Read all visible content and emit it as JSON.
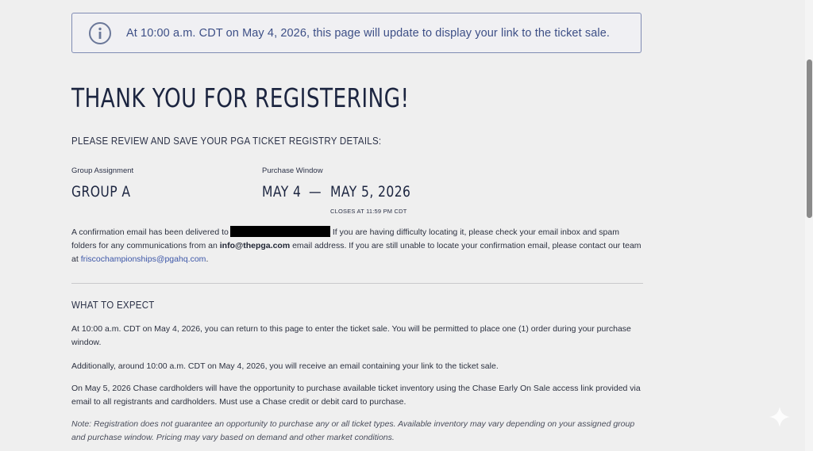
{
  "notice": {
    "icon": "info-icon",
    "text": "At 10:00 a.m. CDT on May 4, 2026, this page will update to display your link to the ticket sale."
  },
  "title": "THANK YOU FOR REGISTERING!",
  "subtitle": "PLEASE REVIEW AND SAVE YOUR PGA TICKET REGISTRY DETAILS:",
  "group": {
    "label": "Group Assignment",
    "value": "GROUP A"
  },
  "window": {
    "label": "Purchase Window",
    "start": "MAY 4",
    "dash": "—",
    "end": "MAY 5, 2026",
    "closes": "CLOSES AT 11:59 PM CDT"
  },
  "confirmation": {
    "part1": "A confirmation email has been delivered to",
    "part2": "If you are having difficulty locating it, please check your email inbox and spam folders for any communications from an",
    "email_bold": "info@thepga.com",
    "part3": "email address. If you are still unable to locate your confirmation email, please contact our team at",
    "contact_link": "friscochampionships@pgahq.com",
    "part4": "."
  },
  "expect": {
    "heading": "WHAT TO EXPECT",
    "p1": "At 10:00 a.m. CDT on May 4, 2026, you can return to this page to enter the ticket sale. You will be permitted to place one (1) order during your purchase window.",
    "p2": "Additionally, around 10:00 a.m. CDT on May 4, 2026, you will receive an email containing your link to the ticket sale.",
    "p3": "On May 5, 2026 Chase cardholders will have the opportunity to purchase available ticket inventory using the Chase Early On Sale access link provided via email to all registrants and cardholders. Must use a Chase credit or debit card to purchase.",
    "note": "Note: Registration does not guarantee an opportunity to purchase any or all ticket types. Available inventory may vary depending on your assigned group and purchase window. Pricing may vary based on demand and other market conditions."
  },
  "colors": {
    "accent": "#3d4f86",
    "link": "#3d57a8",
    "background": "#efefef"
  }
}
